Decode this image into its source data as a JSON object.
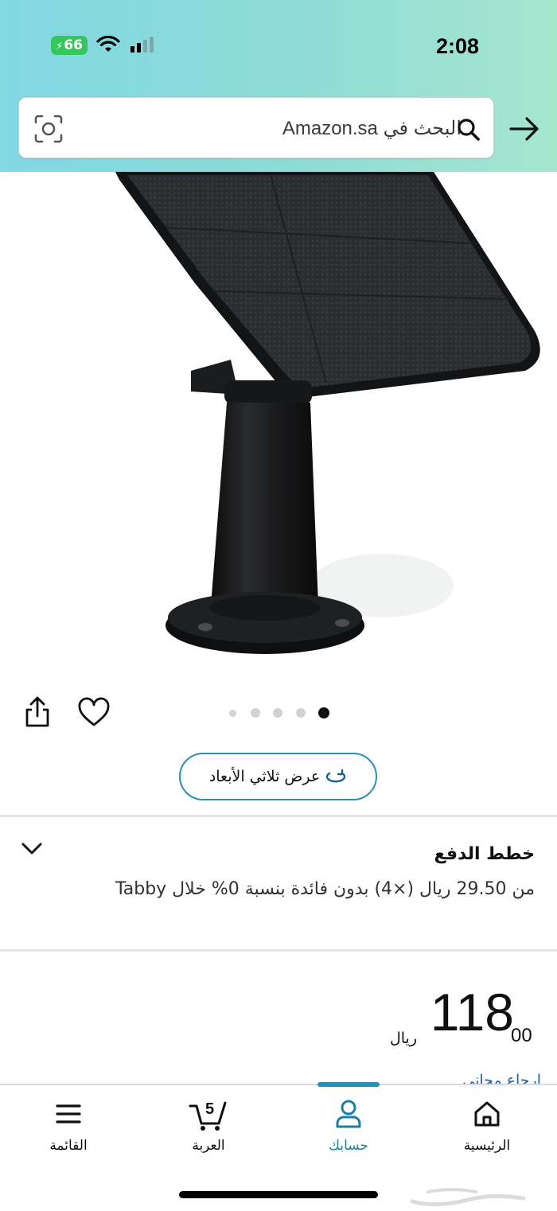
{
  "status_bar": {
    "battery": "66",
    "time": "2:08"
  },
  "search": {
    "placeholder": "البحث في Amazon.sa"
  },
  "product": {
    "image_dots": 5,
    "active_dot": 5,
    "view_3d_label": "عرض ثلاثي الأبعاد"
  },
  "payment_plans": {
    "title": "خطط الدفع",
    "description": "من 29.50 ريال (×4) بدون فائدة بنسبة 0% خلال Tabby"
  },
  "price": {
    "whole": "118",
    "fraction": "00",
    "currency": "ريال"
  },
  "partial_link": "ارجاع مجاني",
  "bottom_nav": {
    "home": "الرئيسية",
    "account": "حسابك",
    "cart": "العربة",
    "cart_count": "5",
    "menu": "القائمة"
  },
  "colors": {
    "accent": "#2a8fb4",
    "header_start": "#82d8e3",
    "header_end": "#a6e6cf"
  }
}
